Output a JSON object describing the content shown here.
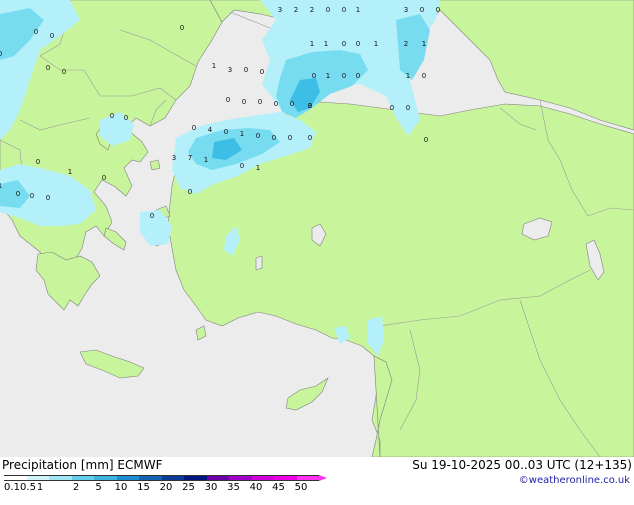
{
  "title": "Precipitation [mm]",
  "model": "ECMWF",
  "valid_time": "Su 19-10-2025 00..03 UTC (12+135)",
  "credit": "©weatheronline.co.uk",
  "colors": {
    "sea": "#ececec",
    "land": "#c8f59b",
    "border": "#9a9a9a",
    "coast": "#808080",
    "precip_light": "#b4f0fa",
    "precip_mid": "#78dcf0",
    "precip_heavy": "#3cbee6"
  },
  "legend": {
    "ticks": [
      "0.1",
      "0.5",
      "1",
      "2",
      "5",
      "10",
      "15",
      "20",
      "25",
      "30",
      "35",
      "40",
      "45",
      "50"
    ],
    "colors": [
      "#ffffff",
      "#d2f5fa",
      "#a0e6f5",
      "#64cdeb",
      "#3cb4e1",
      "#1e8cd2",
      "#1464b4",
      "#0a3c96",
      "#00147d",
      "#6e00aa",
      "#a000c8",
      "#d200dc",
      "#f000e6",
      "#ff32f0"
    ]
  },
  "point_values": {
    "north": [
      "3",
      "2",
      "2",
      "0",
      "0",
      "1",
      "3",
      "0",
      "0"
    ],
    "northeast": [
      "1",
      "1",
      "0",
      "0",
      "1",
      "2",
      "1",
      "0",
      "1",
      "0",
      "0",
      "1",
      "0",
      "0",
      "0"
    ],
    "west": [
      "0",
      "0",
      "0",
      "0",
      "0",
      "0",
      "1",
      "3",
      "0",
      "0",
      "0",
      "0",
      "0",
      "1",
      "0",
      "1",
      "0",
      "0",
      "0"
    ],
    "central": [
      "0",
      "0",
      "0",
      "0",
      "0",
      "0",
      "3",
      "0",
      "0",
      "4",
      "0",
      "1",
      "0",
      "0",
      "0",
      "7",
      "1",
      "0",
      "1",
      "3",
      "0",
      "0",
      "0"
    ]
  }
}
